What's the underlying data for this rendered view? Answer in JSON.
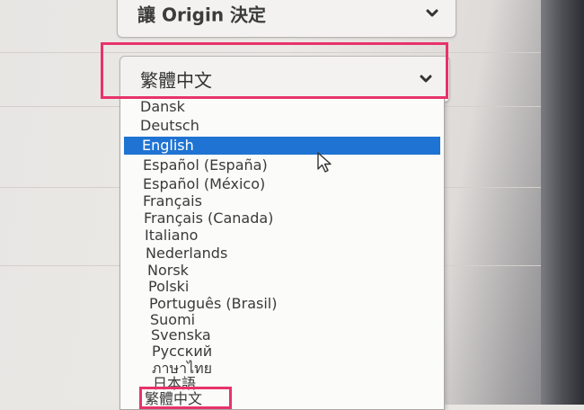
{
  "top_select": {
    "value": "讓 Origin 決定",
    "icon": "chevron-down-icon"
  },
  "language_select": {
    "value": "繁體中文",
    "icon": "chevron-down-icon"
  },
  "dropdown": {
    "selected_index": 2,
    "options": [
      "Dansk",
      "Deutsch",
      "English",
      "Español (España)",
      "Español (México)",
      "Français",
      "Français (Canada)",
      "Italiano",
      "Nederlands",
      "Norsk",
      "Polski",
      "Português (Brasil)",
      "Suomi",
      "Svenska",
      "Русский",
      "ภาษาไทย",
      "日本語",
      "繁體中文"
    ]
  },
  "colors": {
    "highlight": "#e8336a",
    "selection": "#1f73d2"
  }
}
